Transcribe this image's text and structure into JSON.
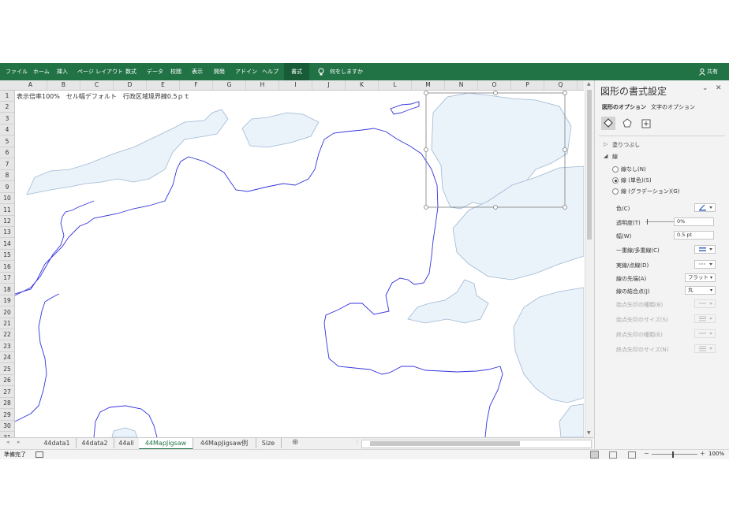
{
  "ribbon": {
    "tabs": [
      "ファイル",
      "ホーム",
      "挿入",
      "ページ レイアウト",
      "数式",
      "データ",
      "校閲",
      "表示",
      "開発",
      "アドイン",
      "ヘルプ",
      "書式"
    ],
    "tell_me": "何をしますか",
    "share": "共有"
  },
  "grid": {
    "columns": [
      "A",
      "B",
      "C",
      "D",
      "E",
      "F",
      "G",
      "H",
      "I",
      "J",
      "K",
      "L",
      "M",
      "N",
      "O",
      "P",
      "Q"
    ],
    "rows": [
      "1",
      "2",
      "3",
      "4",
      "5",
      "6",
      "7",
      "8",
      "9",
      "10",
      "11",
      "12",
      "13",
      "14",
      "15",
      "16",
      "17",
      "18",
      "19",
      "20",
      "21",
      "22",
      "23",
      "24",
      "25",
      "26",
      "27",
      "28",
      "29",
      "30",
      "31"
    ],
    "a1_text": "表示倍率100%　セル幅デフォルト　行政区域境界線0.5ｐｔ"
  },
  "sheet_tabs": [
    "44data1",
    "44data2",
    "44all",
    "44MapJigsaw",
    "44MapJigsaw例",
    "Size"
  ],
  "active_sheet": "44MapJigsaw",
  "status": {
    "ready": "準備完了",
    "zoom": "100%"
  },
  "pane": {
    "title": "図形の書式設定",
    "tab_shape": "図形のオプション",
    "tab_text": "文字のオプション",
    "fill_section": "塗りつぶし",
    "line_section": "線",
    "radio_none": "線なし(N)",
    "radio_solid": "線 (単色)(S)",
    "radio_gradient": "線 (グラデーション)(G)",
    "color_label": "色(C)",
    "transparency_label": "透明度(T)",
    "transparency_value": "0%",
    "width_label": "幅(W)",
    "width_value": "0.5 pt",
    "compound_label": "一重線/多重線(C)",
    "dash_label": "実線/点線(D)",
    "cap_label": "線の先端(A)",
    "cap_value": "フラット",
    "join_label": "線の結合点(J)",
    "join_value": "丸",
    "begin_arrow_type": "始点矢印の種類(B)",
    "begin_arrow_size": "始点矢印のサイズ(S)",
    "end_arrow_type": "終点矢印の種類(E)",
    "end_arrow_size": "終点矢印のサイズ(N)"
  },
  "colors": {
    "ribbon": "#217346",
    "land_fill": "#eaf2fa",
    "land_stroke": "#9fb8d3",
    "boundary": "#3333dd"
  }
}
